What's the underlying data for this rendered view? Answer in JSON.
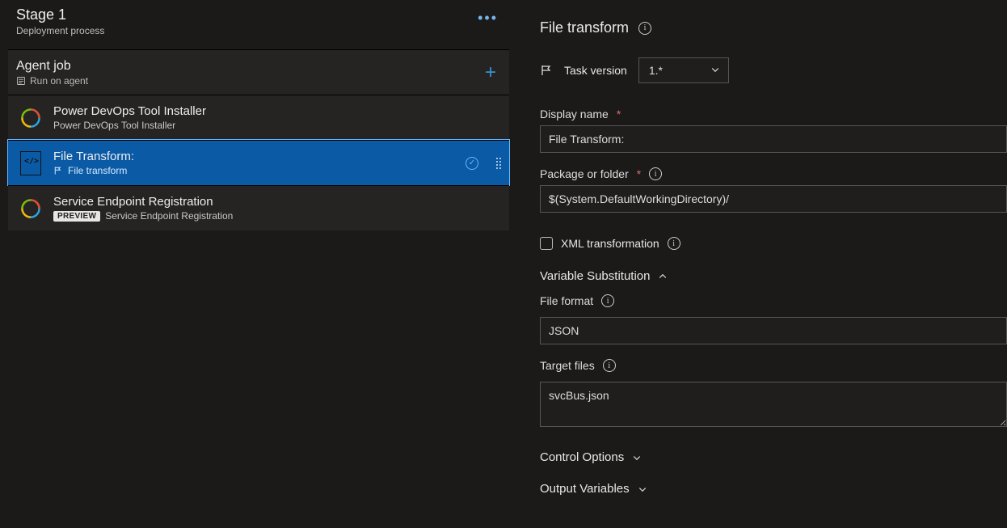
{
  "stage": {
    "title": "Stage 1",
    "subtitle": "Deployment process"
  },
  "job": {
    "title": "Agent job",
    "subtitle": "Run on agent"
  },
  "tasks": [
    {
      "title": "Power DevOps Tool Installer",
      "subtitle": "Power DevOps Tool Installer",
      "preview": false
    },
    {
      "title": "File Transform:",
      "subtitle": "File transform",
      "preview": false,
      "selected": true
    },
    {
      "title": "Service Endpoint Registration",
      "subtitle": "Service Endpoint Registration",
      "preview": true
    }
  ],
  "panel": {
    "title": "File transform",
    "task_version_label": "Task version",
    "task_version_value": "1.*",
    "display_name_label": "Display name",
    "display_name_value": "File Transform:",
    "package_label": "Package or folder",
    "package_value": "$(System.DefaultWorkingDirectory)/",
    "xml_label": "XML transformation",
    "var_sub_header": "Variable Substitution",
    "file_format_label": "File format",
    "file_format_value": "JSON",
    "target_files_label": "Target files",
    "target_files_value": "svcBus.json",
    "control_options": "Control Options",
    "output_vars": "Output Variables",
    "preview_badge": "PREVIEW"
  }
}
